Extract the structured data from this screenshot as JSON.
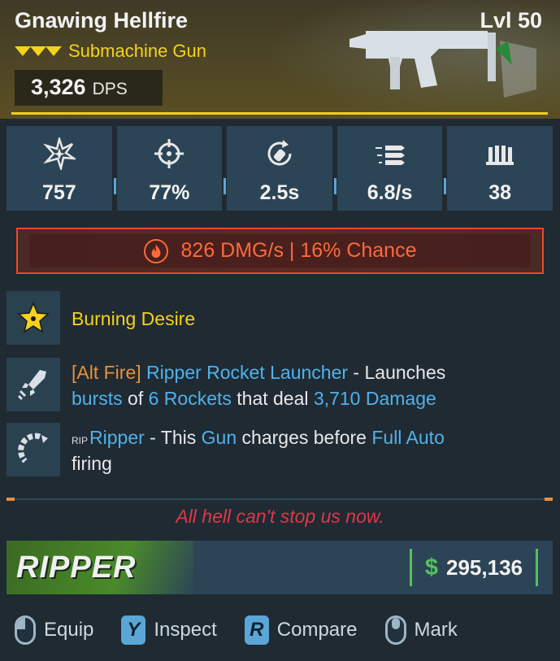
{
  "item": {
    "name": "Gnawing Hellfire",
    "level": "Lvl 50",
    "type": "Submachine Gun",
    "dps_value": "3,326",
    "dps_label": "DPS"
  },
  "stats": [
    {
      "icon": "damage-burst-icon",
      "value": "757"
    },
    {
      "icon": "crosshair-icon",
      "value": "77%"
    },
    {
      "icon": "reload-icon",
      "value": "2.5s"
    },
    {
      "icon": "fire-rate-icon",
      "value": "6.8/s"
    },
    {
      "icon": "magazine-icon",
      "value": "38"
    }
  ],
  "elemental": {
    "icon": "fire-element-icon",
    "text": "826 DMG/s | 16% Chance"
  },
  "perks": {
    "perk1": {
      "text": "Burning Desire"
    },
    "perk2": {
      "p1": "[Alt Fire]",
      "p2": " Ripper Rocket Launcher",
      "p3": " - Launches ",
      "p4": "bursts",
      "p5": " of ",
      "p6": "6 Rockets",
      "p7": " that deal ",
      "p8": "3,710 Damage"
    },
    "perk3": {
      "p1": "Ripper",
      "p2": " - This ",
      "p3": "Gun",
      "p4": " charges before ",
      "p5": "Full Auto",
      "p6": " firing"
    }
  },
  "flavor_text": "All hell can't stop us now.",
  "brand": {
    "name": "RIPPER"
  },
  "price": {
    "symbol": "$",
    "value": "295,136"
  },
  "actions": [
    {
      "key": "",
      "label": "Equip"
    },
    {
      "key": "Y",
      "label": "Inspect"
    },
    {
      "key": "R",
      "label": "Compare"
    },
    {
      "key": "",
      "label": "Mark"
    }
  ],
  "colors": {
    "accent_yellow": "#f5d21c",
    "element_fire": "#ff6a3a",
    "perk_blue": "#4fb2ec",
    "money_green": "#55c25a"
  }
}
